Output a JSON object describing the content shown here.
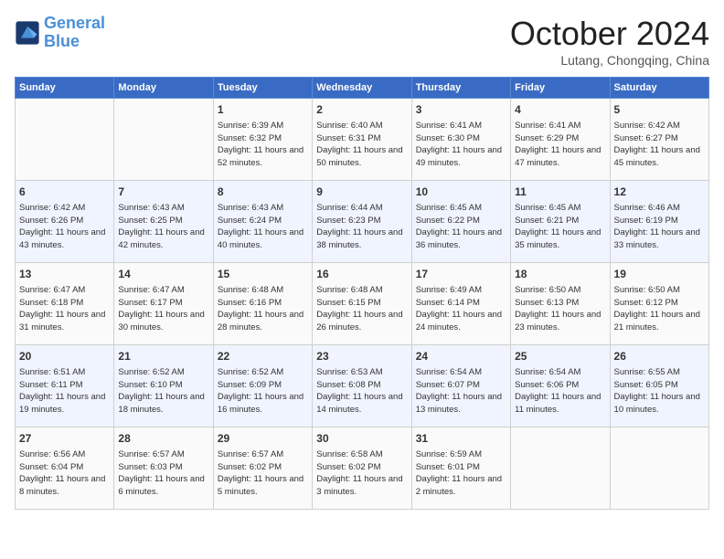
{
  "header": {
    "logo_line1": "General",
    "logo_line2": "Blue",
    "month": "October 2024",
    "location": "Lutang, Chongqing, China"
  },
  "weekdays": [
    "Sunday",
    "Monday",
    "Tuesday",
    "Wednesday",
    "Thursday",
    "Friday",
    "Saturday"
  ],
  "weeks": [
    [
      {
        "day": "",
        "sunrise": "",
        "sunset": "",
        "daylight": ""
      },
      {
        "day": "",
        "sunrise": "",
        "sunset": "",
        "daylight": ""
      },
      {
        "day": "1",
        "sunrise": "Sunrise: 6:39 AM",
        "sunset": "Sunset: 6:32 PM",
        "daylight": "Daylight: 11 hours and 52 minutes."
      },
      {
        "day": "2",
        "sunrise": "Sunrise: 6:40 AM",
        "sunset": "Sunset: 6:31 PM",
        "daylight": "Daylight: 11 hours and 50 minutes."
      },
      {
        "day": "3",
        "sunrise": "Sunrise: 6:41 AM",
        "sunset": "Sunset: 6:30 PM",
        "daylight": "Daylight: 11 hours and 49 minutes."
      },
      {
        "day": "4",
        "sunrise": "Sunrise: 6:41 AM",
        "sunset": "Sunset: 6:29 PM",
        "daylight": "Daylight: 11 hours and 47 minutes."
      },
      {
        "day": "5",
        "sunrise": "Sunrise: 6:42 AM",
        "sunset": "Sunset: 6:27 PM",
        "daylight": "Daylight: 11 hours and 45 minutes."
      }
    ],
    [
      {
        "day": "6",
        "sunrise": "Sunrise: 6:42 AM",
        "sunset": "Sunset: 6:26 PM",
        "daylight": "Daylight: 11 hours and 43 minutes."
      },
      {
        "day": "7",
        "sunrise": "Sunrise: 6:43 AM",
        "sunset": "Sunset: 6:25 PM",
        "daylight": "Daylight: 11 hours and 42 minutes."
      },
      {
        "day": "8",
        "sunrise": "Sunrise: 6:43 AM",
        "sunset": "Sunset: 6:24 PM",
        "daylight": "Daylight: 11 hours and 40 minutes."
      },
      {
        "day": "9",
        "sunrise": "Sunrise: 6:44 AM",
        "sunset": "Sunset: 6:23 PM",
        "daylight": "Daylight: 11 hours and 38 minutes."
      },
      {
        "day": "10",
        "sunrise": "Sunrise: 6:45 AM",
        "sunset": "Sunset: 6:22 PM",
        "daylight": "Daylight: 11 hours and 36 minutes."
      },
      {
        "day": "11",
        "sunrise": "Sunrise: 6:45 AM",
        "sunset": "Sunset: 6:21 PM",
        "daylight": "Daylight: 11 hours and 35 minutes."
      },
      {
        "day": "12",
        "sunrise": "Sunrise: 6:46 AM",
        "sunset": "Sunset: 6:19 PM",
        "daylight": "Daylight: 11 hours and 33 minutes."
      }
    ],
    [
      {
        "day": "13",
        "sunrise": "Sunrise: 6:47 AM",
        "sunset": "Sunset: 6:18 PM",
        "daylight": "Daylight: 11 hours and 31 minutes."
      },
      {
        "day": "14",
        "sunrise": "Sunrise: 6:47 AM",
        "sunset": "Sunset: 6:17 PM",
        "daylight": "Daylight: 11 hours and 30 minutes."
      },
      {
        "day": "15",
        "sunrise": "Sunrise: 6:48 AM",
        "sunset": "Sunset: 6:16 PM",
        "daylight": "Daylight: 11 hours and 28 minutes."
      },
      {
        "day": "16",
        "sunrise": "Sunrise: 6:48 AM",
        "sunset": "Sunset: 6:15 PM",
        "daylight": "Daylight: 11 hours and 26 minutes."
      },
      {
        "day": "17",
        "sunrise": "Sunrise: 6:49 AM",
        "sunset": "Sunset: 6:14 PM",
        "daylight": "Daylight: 11 hours and 24 minutes."
      },
      {
        "day": "18",
        "sunrise": "Sunrise: 6:50 AM",
        "sunset": "Sunset: 6:13 PM",
        "daylight": "Daylight: 11 hours and 23 minutes."
      },
      {
        "day": "19",
        "sunrise": "Sunrise: 6:50 AM",
        "sunset": "Sunset: 6:12 PM",
        "daylight": "Daylight: 11 hours and 21 minutes."
      }
    ],
    [
      {
        "day": "20",
        "sunrise": "Sunrise: 6:51 AM",
        "sunset": "Sunset: 6:11 PM",
        "daylight": "Daylight: 11 hours and 19 minutes."
      },
      {
        "day": "21",
        "sunrise": "Sunrise: 6:52 AM",
        "sunset": "Sunset: 6:10 PM",
        "daylight": "Daylight: 11 hours and 18 minutes."
      },
      {
        "day": "22",
        "sunrise": "Sunrise: 6:52 AM",
        "sunset": "Sunset: 6:09 PM",
        "daylight": "Daylight: 11 hours and 16 minutes."
      },
      {
        "day": "23",
        "sunrise": "Sunrise: 6:53 AM",
        "sunset": "Sunset: 6:08 PM",
        "daylight": "Daylight: 11 hours and 14 minutes."
      },
      {
        "day": "24",
        "sunrise": "Sunrise: 6:54 AM",
        "sunset": "Sunset: 6:07 PM",
        "daylight": "Daylight: 11 hours and 13 minutes."
      },
      {
        "day": "25",
        "sunrise": "Sunrise: 6:54 AM",
        "sunset": "Sunset: 6:06 PM",
        "daylight": "Daylight: 11 hours and 11 minutes."
      },
      {
        "day": "26",
        "sunrise": "Sunrise: 6:55 AM",
        "sunset": "Sunset: 6:05 PM",
        "daylight": "Daylight: 11 hours and 10 minutes."
      }
    ],
    [
      {
        "day": "27",
        "sunrise": "Sunrise: 6:56 AM",
        "sunset": "Sunset: 6:04 PM",
        "daylight": "Daylight: 11 hours and 8 minutes."
      },
      {
        "day": "28",
        "sunrise": "Sunrise: 6:57 AM",
        "sunset": "Sunset: 6:03 PM",
        "daylight": "Daylight: 11 hours and 6 minutes."
      },
      {
        "day": "29",
        "sunrise": "Sunrise: 6:57 AM",
        "sunset": "Sunset: 6:02 PM",
        "daylight": "Daylight: 11 hours and 5 minutes."
      },
      {
        "day": "30",
        "sunrise": "Sunrise: 6:58 AM",
        "sunset": "Sunset: 6:02 PM",
        "daylight": "Daylight: 11 hours and 3 minutes."
      },
      {
        "day": "31",
        "sunrise": "Sunrise: 6:59 AM",
        "sunset": "Sunset: 6:01 PM",
        "daylight": "Daylight: 11 hours and 2 minutes."
      },
      {
        "day": "",
        "sunrise": "",
        "sunset": "",
        "daylight": ""
      },
      {
        "day": "",
        "sunrise": "",
        "sunset": "",
        "daylight": ""
      }
    ]
  ]
}
